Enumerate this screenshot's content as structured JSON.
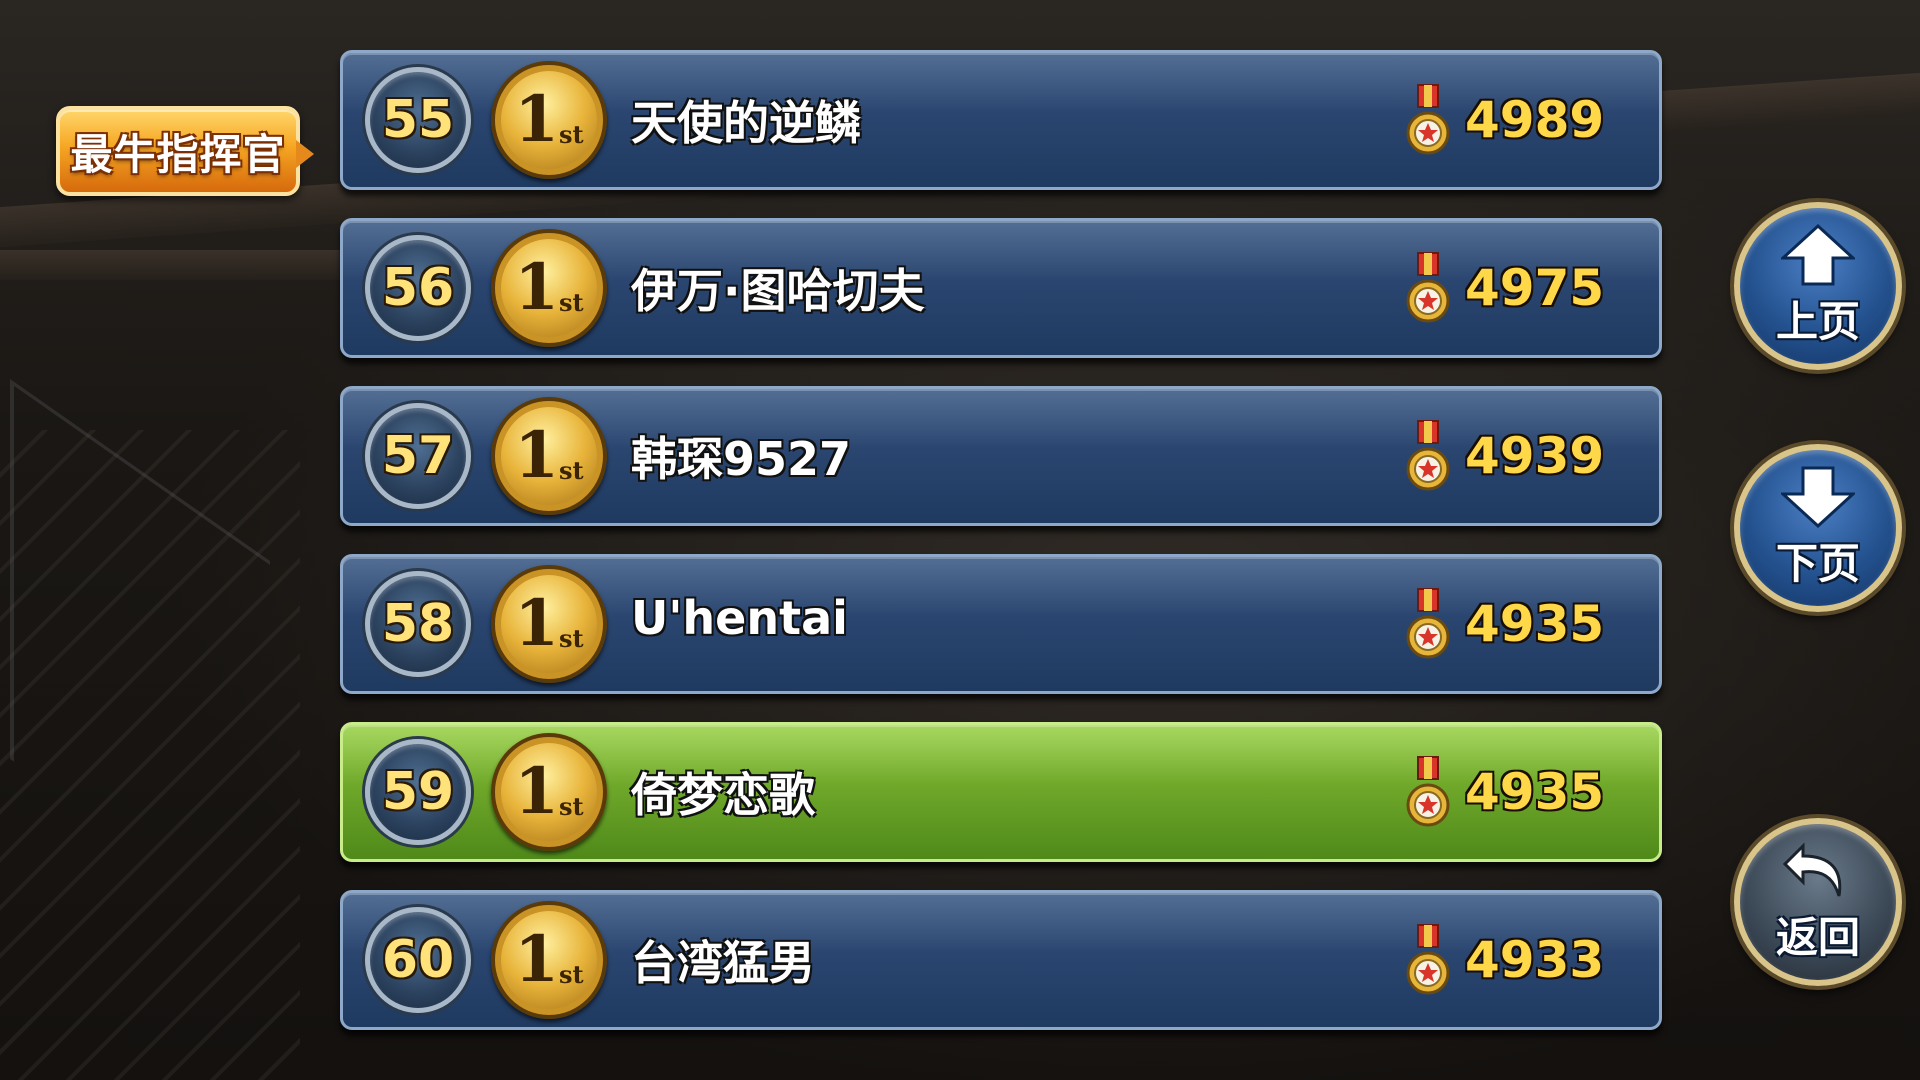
{
  "leaderboard": {
    "category_tag": "最牛指挥官",
    "rows": [
      {
        "rank": "55",
        "medal": "1",
        "medal_sup": "st",
        "name": "天使的逆鳞",
        "score": "4989",
        "highlight": false
      },
      {
        "rank": "56",
        "medal": "1",
        "medal_sup": "st",
        "name": "伊万·图哈切夫",
        "score": "4975",
        "highlight": false
      },
      {
        "rank": "57",
        "medal": "1",
        "medal_sup": "st",
        "name": "韩琛9527",
        "score": "4939",
        "highlight": false
      },
      {
        "rank": "58",
        "medal": "1",
        "medal_sup": "st",
        "name": "U'hentai",
        "score": "4935",
        "highlight": false
      },
      {
        "rank": "59",
        "medal": "1",
        "medal_sup": "st",
        "name": "倚梦恋歌",
        "score": "4935",
        "highlight": true
      },
      {
        "rank": "60",
        "medal": "1",
        "medal_sup": "st",
        "name": "台湾猛男",
        "score": "4933",
        "highlight": false
      }
    ]
  },
  "nav": {
    "prev_page": {
      "label": "上页",
      "icon": "arrow-up-icon"
    },
    "next_page": {
      "label": "下页",
      "icon": "arrow-down-icon"
    },
    "back": {
      "label": "返回",
      "icon": "return-icon"
    }
  },
  "colors": {
    "row_default": "#2a4670",
    "row_highlight": "#6fa82a",
    "score": "#ffd84a",
    "rank": "#ffe27a",
    "tag": "#f6a623"
  }
}
